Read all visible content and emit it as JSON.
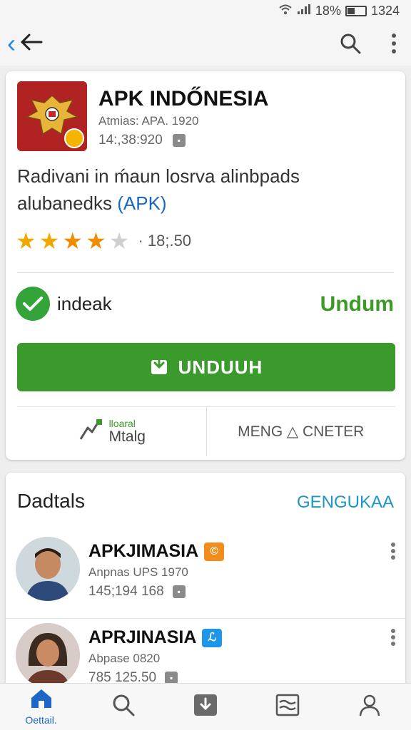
{
  "status_bar": {
    "battery": "18%",
    "time": "1324"
  },
  "app": {
    "title": "APK INDŐNESIA",
    "subtitle": "Atmias: APA. 1920",
    "meta": "14:,38:920",
    "description_main": "Radivani in ḿaun losrva alinbpads alubanedks ",
    "description_link": "(APK)",
    "rating_count": "· 18;.50",
    "stars": {
      "full": 2,
      "half": 2,
      "empty": 1
    },
    "verify_label": "indeak",
    "status_label": "Undum",
    "download_label": "UNDUUH",
    "action_left_top": "lloaral",
    "action_left_bottom": "Mtalg",
    "action_right": "MENG △ CNETER"
  },
  "details": {
    "title": "Dadtals",
    "more_label": "GENGUKAA",
    "items": [
      {
        "name": "APKJIMASIA",
        "sub": "Anpnas UPS 1970",
        "meta": "145;194 168",
        "tag_color": "#f28c1a"
      },
      {
        "name": "APRJINASIA",
        "sub": "Abpase 0820",
        "meta": "785 125.50",
        "tag_color": "#1e96e8"
      }
    ]
  },
  "bottom_nav": {
    "home_label": "Oettail."
  },
  "colors": {
    "primary_green": "#3a9b2c",
    "link_blue": "#1a66c9",
    "accent_blue": "#1e96c8",
    "star_gold": "#f0a800"
  },
  "icons": [
    "wifi-icon",
    "signal-icon",
    "battery-icon",
    "back-arrow-icon",
    "search-icon",
    "more-vert-icon",
    "check-circle-icon",
    "download-icon",
    "home-icon",
    "apps-icon",
    "library-icon",
    "account-icon"
  ]
}
